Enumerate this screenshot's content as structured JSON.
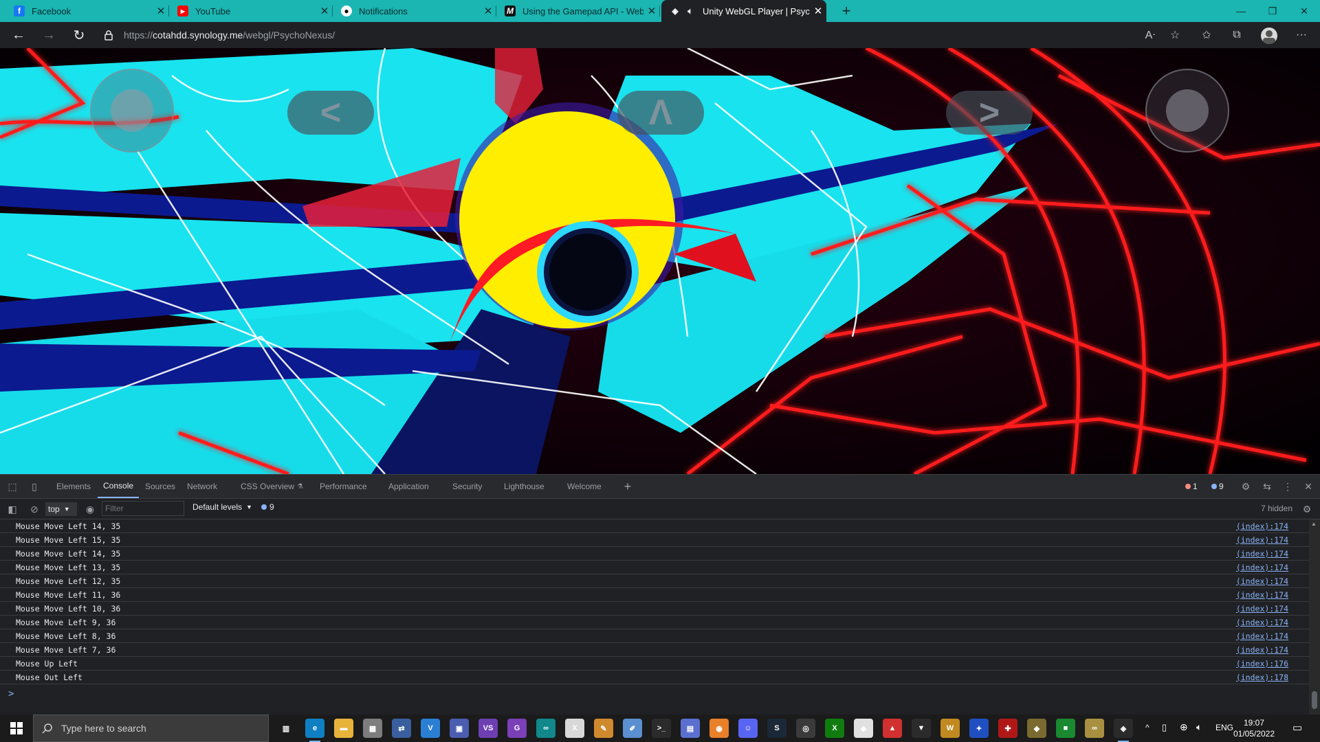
{
  "browser": {
    "tabs": [
      {
        "title": "Facebook",
        "icon": "facebook-icon",
        "active": false
      },
      {
        "title": "YouTube",
        "icon": "youtube-icon",
        "active": false
      },
      {
        "title": "Notifications",
        "icon": "github-icon",
        "active": false
      },
      {
        "title": "Using the Gamepad API - Web A",
        "icon": "mdn-icon",
        "active": false
      },
      {
        "title": "Unity WebGL Player | Psych",
        "icon": "unity-icon",
        "active": true
      }
    ],
    "new_tab_label": "+",
    "url_prefix": "https://",
    "url_host": "cotahdd.synology.me",
    "url_path": "/webgl/PsychoNexus/",
    "accent_color": "#1bb5b2"
  },
  "game": {
    "buttons": {
      "left_label": "<",
      "up_label": "Λ",
      "right_label": ">"
    }
  },
  "devtools": {
    "tabs": [
      {
        "label": "Elements"
      },
      {
        "label": "Console",
        "active": true
      },
      {
        "label": "Sources"
      },
      {
        "label": "Network"
      },
      {
        "label": "CSS Overview"
      },
      {
        "label": "Performance"
      },
      {
        "label": "Application"
      },
      {
        "label": "Security"
      },
      {
        "label": "Lighthouse"
      },
      {
        "label": "Welcome"
      }
    ],
    "error_count": "1",
    "message_count": "9",
    "context": "top",
    "filter_placeholder": "Filter",
    "levels": "Default levels",
    "levels_badge": "9",
    "hidden_count": "7 hidden",
    "console": [
      {
        "msg": "Mouse Move Left 14, 35",
        "src": "(index):174"
      },
      {
        "msg": "Mouse Move Left 15, 35",
        "src": "(index):174"
      },
      {
        "msg": "Mouse Move Left 14, 35",
        "src": "(index):174"
      },
      {
        "msg": "Mouse Move Left 13, 35",
        "src": "(index):174"
      },
      {
        "msg": "Mouse Move Left 12, 35",
        "src": "(index):174"
      },
      {
        "msg": "Mouse Move Left 11, 36",
        "src": "(index):174"
      },
      {
        "msg": "Mouse Move Left 10, 36",
        "src": "(index):174"
      },
      {
        "msg": "Mouse Move Left 9, 36",
        "src": "(index):174"
      },
      {
        "msg": "Mouse Move Left 8, 36",
        "src": "(index):174"
      },
      {
        "msg": "Mouse Move Left 7, 36",
        "src": "(index):174"
      },
      {
        "msg": "Mouse Up Left",
        "src": "(index):176"
      },
      {
        "msg": "Mouse Out Left",
        "src": "(index):178"
      }
    ],
    "prompt": ">"
  },
  "taskbar": {
    "search_placeholder": "Type here to search",
    "language": "ENG",
    "time": "19:07",
    "date": "01/05/2022",
    "apps": [
      {
        "name": "task-view-icon",
        "glyph": "▥",
        "color": "#1b1b1b"
      },
      {
        "name": "edge-icon",
        "glyph": "e",
        "color": "#0f7fc4"
      },
      {
        "name": "file-explorer-icon",
        "glyph": "▬",
        "color": "#e8b33b"
      },
      {
        "name": "photos-icon",
        "glyph": "▦",
        "color": "#7d7d7d"
      },
      {
        "name": "network-tool-icon",
        "glyph": "⇄",
        "color": "#3a5f9e"
      },
      {
        "name": "vscode-icon",
        "glyph": "V",
        "color": "#2a7fd4"
      },
      {
        "name": "virtualbox-icon",
        "glyph": "▣",
        "color": "#4a5db0"
      },
      {
        "name": "visual-studio-icon",
        "glyph": "VS",
        "color": "#6d3fb3"
      },
      {
        "name": "github-desktop-icon",
        "glyph": "G",
        "color": "#7b3fb8"
      },
      {
        "name": "arduino-icon",
        "glyph": "∞",
        "color": "#10888c"
      },
      {
        "name": "excel-tool-icon",
        "glyph": "X",
        "color": "#d8d8d8"
      },
      {
        "name": "paint-icon",
        "glyph": "✎",
        "color": "#d08a2e"
      },
      {
        "name": "notes-icon",
        "glyph": "✐",
        "color": "#5a8fd0"
      },
      {
        "name": "terminal-icon",
        "glyph": ">_",
        "color": "#2b2b2b"
      },
      {
        "name": "document-icon",
        "glyph": "▤",
        "color": "#5a6fd0"
      },
      {
        "name": "blender-icon",
        "glyph": "◉",
        "color": "#e8802a"
      },
      {
        "name": "discord-icon",
        "glyph": "☺",
        "color": "#5865f2"
      },
      {
        "name": "steam-icon",
        "glyph": "S",
        "color": "#1b2838"
      },
      {
        "name": "obs-icon",
        "glyph": "◎",
        "color": "#3a3a3a"
      },
      {
        "name": "xbox-icon",
        "glyph": "X",
        "color": "#107c10"
      },
      {
        "name": "unity-hub-icon",
        "glyph": "◈",
        "color": "#e0e0e0"
      },
      {
        "name": "game-launcher-icon",
        "glyph": "▲",
        "color": "#d03030"
      },
      {
        "name": "destiny-icon",
        "glyph": "▼",
        "color": "#2b2b2b"
      },
      {
        "name": "warcraft-icon",
        "glyph": "W",
        "color": "#c08a20"
      },
      {
        "name": "battlenet-icon",
        "glyph": "✦",
        "color": "#2050c0"
      },
      {
        "name": "game-red-icon",
        "glyph": "✚",
        "color": "#b01818"
      },
      {
        "name": "game-gold-icon",
        "glyph": "◆",
        "color": "#7a6a30"
      },
      {
        "name": "game-green-icon",
        "glyph": "■",
        "color": "#1a8a30"
      },
      {
        "name": "game-glasses-icon",
        "glyph": "∞",
        "color": "#a89040"
      },
      {
        "name": "unity-icon",
        "glyph": "◈",
        "color": "#2b2b2b"
      }
    ]
  }
}
